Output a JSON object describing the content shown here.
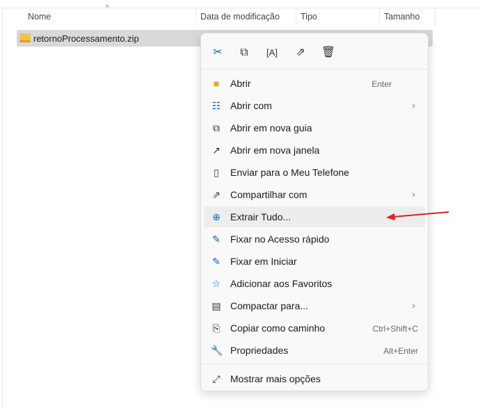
{
  "columns": {
    "name": "Nome",
    "date": "Data de modificação",
    "type": "Tipo",
    "size": "Tamanho"
  },
  "file": {
    "name": "retornoProcessamento.zip"
  },
  "toolbar": [
    "cut-icon",
    "copy-icon",
    "rename-icon",
    "share-icon",
    "delete-icon"
  ],
  "menu": {
    "items": [
      {
        "label": "Abrir",
        "shortcut": "Enter"
      },
      {
        "label": "Abrir com",
        "submenu": true
      },
      {
        "label": "Abrir em nova guia"
      },
      {
        "label": "Abrir em nova janela"
      },
      {
        "label": "Enviar para o Meu Telefone"
      },
      {
        "label": "Compartilhar com",
        "submenu": true
      },
      {
        "label": "Extrair Tudo..."
      },
      {
        "label": "Fixar no Acesso rápido"
      },
      {
        "label": "Fixar em Iniciar"
      },
      {
        "label": "Adicionar aos Favoritos"
      },
      {
        "label": "Compactar para...",
        "submenu": true
      },
      {
        "label": "Copiar como caminho",
        "shortcut": "Ctrl+Shift+C"
      },
      {
        "label": "Propriedades",
        "shortcut": "Alt+Enter"
      }
    ],
    "more": "Mostrar mais opções"
  },
  "colors": {
    "accent": "#0067c0",
    "arrow": "#e02020",
    "highlight": "#ededed"
  }
}
